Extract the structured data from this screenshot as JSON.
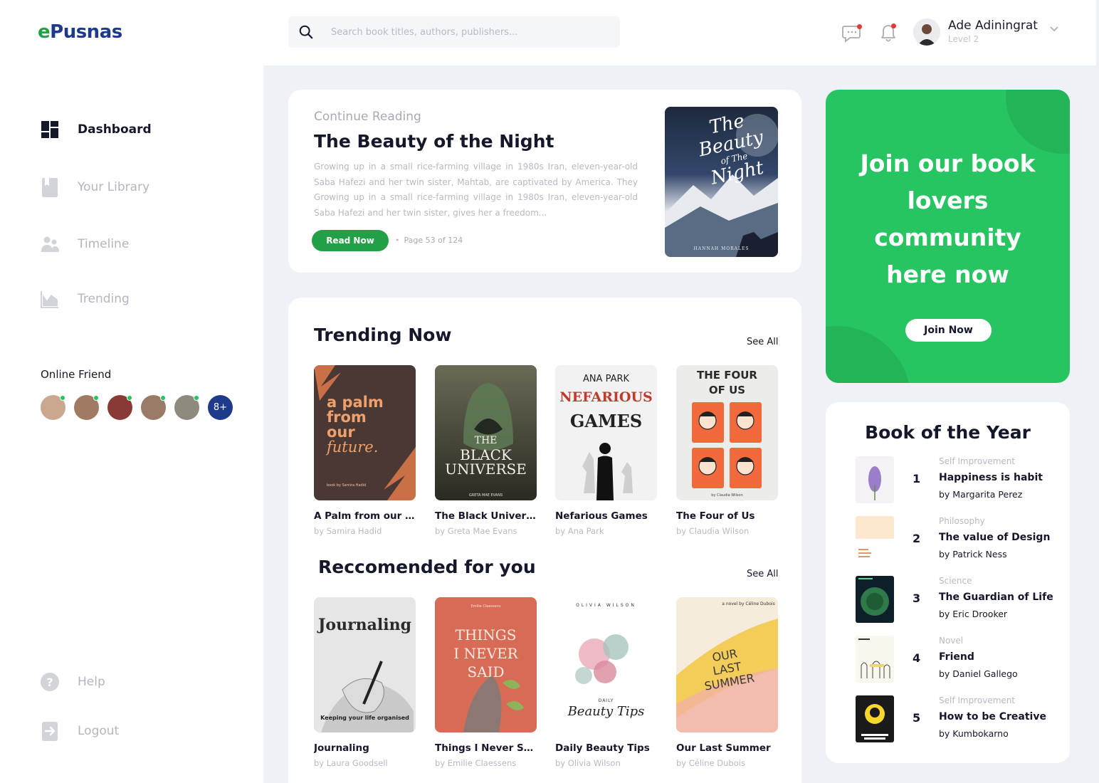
{
  "app": {
    "logo_e": "e",
    "logo_rest": "Pusnas"
  },
  "search": {
    "placeholder": "Search book titles, authors, publishers..."
  },
  "user": {
    "name": "Ade Adiningrat",
    "level": "Level 2"
  },
  "sidebar": {
    "items": [
      {
        "label": "Dashboard"
      },
      {
        "label": "Your Library"
      },
      {
        "label": "Timeline"
      },
      {
        "label": "Trending"
      }
    ],
    "online_title": "Online Friend",
    "online_more": "8+",
    "bottom": [
      {
        "label": "Help"
      },
      {
        "label": "Logout"
      }
    ]
  },
  "continue": {
    "label": "Continue Reading",
    "title": "The Beauty of the Night",
    "description": "Growing up in a small rice-farming village in 1980s Iran, eleven-year-old Saba Hafezi and her twin sister, Mahtab, are captivated by America. They Growing up in a small rice-farming village in 1980s Iran, eleven-year-old Saba Hafezi and her twin sister, gives her a freedom...",
    "button": "Read Now",
    "page": "Page 53 of 124",
    "cover_title": [
      "The",
      "Beauty",
      "of The",
      "Night"
    ],
    "cover_author": "HANNAH MORALES"
  },
  "trending": {
    "title": "Trending Now",
    "see_all": "See All",
    "books": [
      {
        "title": "A Palm from our Fu..",
        "author": "by Samira Hadid",
        "cover_lines": [
          "a palm",
          "from",
          "our",
          "future."
        ],
        "cover_small": "book by Samira Hadid"
      },
      {
        "title": "The Black Universe",
        "author": "by Greta Mae Evans",
        "cover_lines": [
          "THE",
          "BLACK",
          "UNIVERSE"
        ],
        "cover_small": "GRETA MAE EVANS"
      },
      {
        "title": "Nefarious Games",
        "author": "by Ana Park",
        "cover_lines": [
          "ANA PARK",
          "NEFARIOUS",
          "GAMES"
        ]
      },
      {
        "title": "The Four of Us",
        "author": "by Claudia Wilson",
        "cover_lines": [
          "THE FOUR",
          "OF US"
        ],
        "cover_small": "by Claudia Wilson"
      }
    ]
  },
  "recommended": {
    "title": "Reccomended for you",
    "see_all": "See All",
    "books": [
      {
        "title": "Journaling",
        "author": "by Laura Goodsell",
        "cover_lines": [
          "Journaling"
        ],
        "cover_small": "Keeping your life organised"
      },
      {
        "title": "Things I Never Said",
        "author": "by Emilie Claessens",
        "cover_lines": [
          "THINGS",
          "I NEVER",
          "SAID"
        ],
        "cover_small": "Emilie Claessens"
      },
      {
        "title": "Daily Beauty Tips",
        "author": "by Olivia Wilson",
        "cover_lines": [
          "OLIVIA WILSON",
          "DAILY",
          "Beauty Tips"
        ]
      },
      {
        "title": "Our Last Summer",
        "author": "by Céline Dubois",
        "cover_lines": [
          "OUR",
          "LAST",
          "SUMMER"
        ],
        "cover_small": "a novel by Céline Dubois"
      }
    ]
  },
  "promo": {
    "text": "Join our book lovers community here now",
    "button": "Join Now"
  },
  "book_of_year": {
    "title": "Book of the Year",
    "items": [
      {
        "rank": "1",
        "category": "Self Improvement",
        "title": "Happiness is habit",
        "author": "by Margarita Perez"
      },
      {
        "rank": "2",
        "category": "Philosophy",
        "title": "The value of Design",
        "author": "by Patrick Ness"
      },
      {
        "rank": "3",
        "category": "Science",
        "title": "The Guardian of Life",
        "author": "by Eric Drooker"
      },
      {
        "rank": "4",
        "category": "Novel",
        "title": "Friend",
        "author": "by Daniel Gallego"
      },
      {
        "rank": "5",
        "category": "Self Improvement",
        "title": "How to be Creative",
        "author": "by Kumbokarno"
      }
    ]
  },
  "colors": {
    "brand_green": "#22a045",
    "brand_blue": "#1e3a8a",
    "promo_green": "#27c562",
    "notification_red": "#e53935"
  }
}
